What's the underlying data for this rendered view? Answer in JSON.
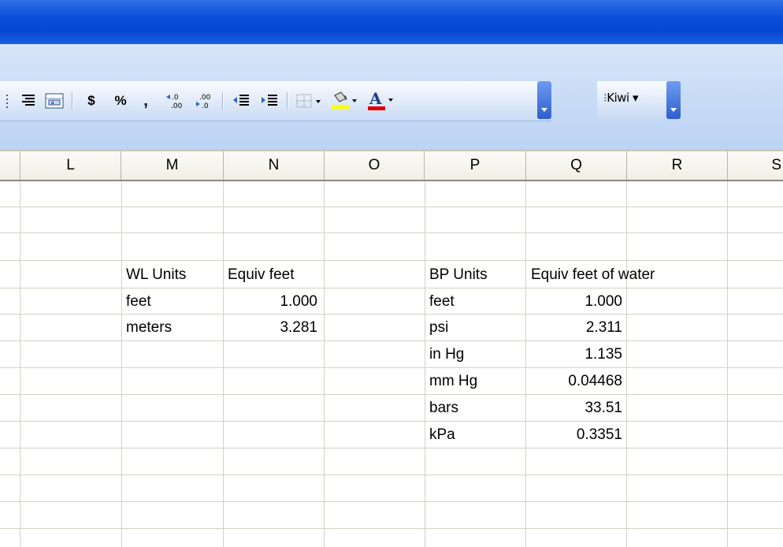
{
  "toolbar": {
    "currency": "$",
    "percent": "%",
    "comma": ",",
    "increase_decimal": "←.0\n.00",
    "decrease_decimal": ".00\n→.0",
    "style_box_label": "Kiwi ▾",
    "font_color_underline": "#e00000",
    "fill_color_underline": "#ffff00"
  },
  "columns": [
    "L",
    "M",
    "N",
    "O",
    "P",
    "Q",
    "R",
    "S"
  ],
  "wl_table": {
    "header_units": "WL Units",
    "header_equiv": "Equiv feet",
    "rows": [
      {
        "unit": "feet",
        "value": "1.000"
      },
      {
        "unit": "meters",
        "value": "3.281"
      }
    ]
  },
  "bp_table": {
    "header_units": "BP Units",
    "header_equiv": "Equiv feet of water",
    "rows": [
      {
        "unit": "feet",
        "value": "1.000"
      },
      {
        "unit": "psi",
        "value": "2.311"
      },
      {
        "unit": "in Hg",
        "value": "1.135"
      },
      {
        "unit": "mm Hg",
        "value": "0.04468"
      },
      {
        "unit": "bars",
        "value": "33.51"
      },
      {
        "unit": "kPa",
        "value": "0.3351"
      }
    ]
  }
}
